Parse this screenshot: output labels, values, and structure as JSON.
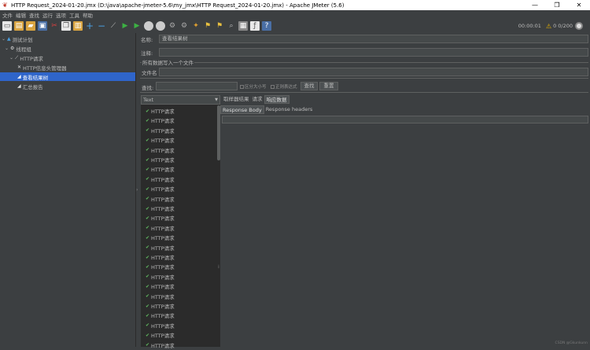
{
  "window": {
    "title": "HTTP Request_2024-01-20.jmx (D:\\java\\apache-jmeter-5.6\\my_jmx\\HTTP Request_2024-01-20.jmx) - Apache JMeter (5.6)",
    "min_glyph": "—",
    "max_glyph": "❐",
    "close_glyph": "✕"
  },
  "menu": [
    "文件",
    "编辑",
    "查找",
    "运行",
    "选项",
    "工具",
    "帮助"
  ],
  "toolbar": {
    "icons": [
      "new-icon",
      "templates-icon",
      "open-icon",
      "save-icon",
      "cut-icon",
      "copy-icon",
      "paste-icon",
      "expand-icon",
      "collapse-icon",
      "toggle-icon",
      "start-icon",
      "start-no-pause-icon",
      "stop-icon",
      "shutdown-icon",
      "remote-start-icon",
      "remote-stop-icon",
      "remote-shutdown-icon",
      "clear-icon",
      "clear-all-icon",
      "search-icon",
      "reset-search-icon",
      "function-helper-icon",
      "help-icon"
    ],
    "elapsed": "00:00:01",
    "warning_count": "0",
    "threads": "0/200"
  },
  "tree": [
    {
      "label": "测试计划",
      "icon": "test-plan-icon",
      "depth": 0
    },
    {
      "label": "线程组",
      "icon": "thread-group-icon",
      "depth": 1
    },
    {
      "label": "HTTP请求",
      "icon": "sampler-icon",
      "depth": 2
    },
    {
      "label": "HTTP信息头管理器",
      "icon": "config-icon",
      "depth": 3
    },
    {
      "label": "查看结果树",
      "icon": "listener-icon",
      "depth": 3,
      "selected": true
    },
    {
      "label": "汇总报告",
      "icon": "listener-icon",
      "depth": 3
    }
  ],
  "form": {
    "name_label": "名称:",
    "name_value": "查看结果树",
    "comment_label": "注释:",
    "comment_value": "",
    "file_group_label": "所有数据写入一个文件",
    "filename_label": "文件名",
    "search_label": "查找:",
    "case_sensitive_label": "区分大小写",
    "regex_label": "正则表达式",
    "search_button": "查找",
    "reset_button": "重置"
  },
  "results": {
    "renderer": "Text",
    "rows": [
      "HTTP请求",
      "HTTP请求",
      "HTTP请求",
      "HTTP请求",
      "HTTP请求",
      "HTTP请求",
      "HTTP请求",
      "HTTP请求",
      "HTTP请求",
      "HTTP请求",
      "HTTP请求",
      "HTTP请求",
      "HTTP请求",
      "HTTP请求",
      "HTTP请求",
      "HTTP请求",
      "HTTP请求",
      "HTTP请求",
      "HTTP请求",
      "HTTP请求",
      "HTTP请求",
      "HTTP请求",
      "HTTP请求",
      "HTTP请求",
      "HTTP请求"
    ]
  },
  "detail_tabs": [
    {
      "label": "取样器结果",
      "active": false
    },
    {
      "label": "请求",
      "active": false
    },
    {
      "label": "响应数据",
      "active": true
    }
  ],
  "response_tabs": [
    {
      "label": "Response Body",
      "active": true
    },
    {
      "label": "Response headers",
      "active": false
    }
  ],
  "watermark": "CSDN @Gkunkunn"
}
